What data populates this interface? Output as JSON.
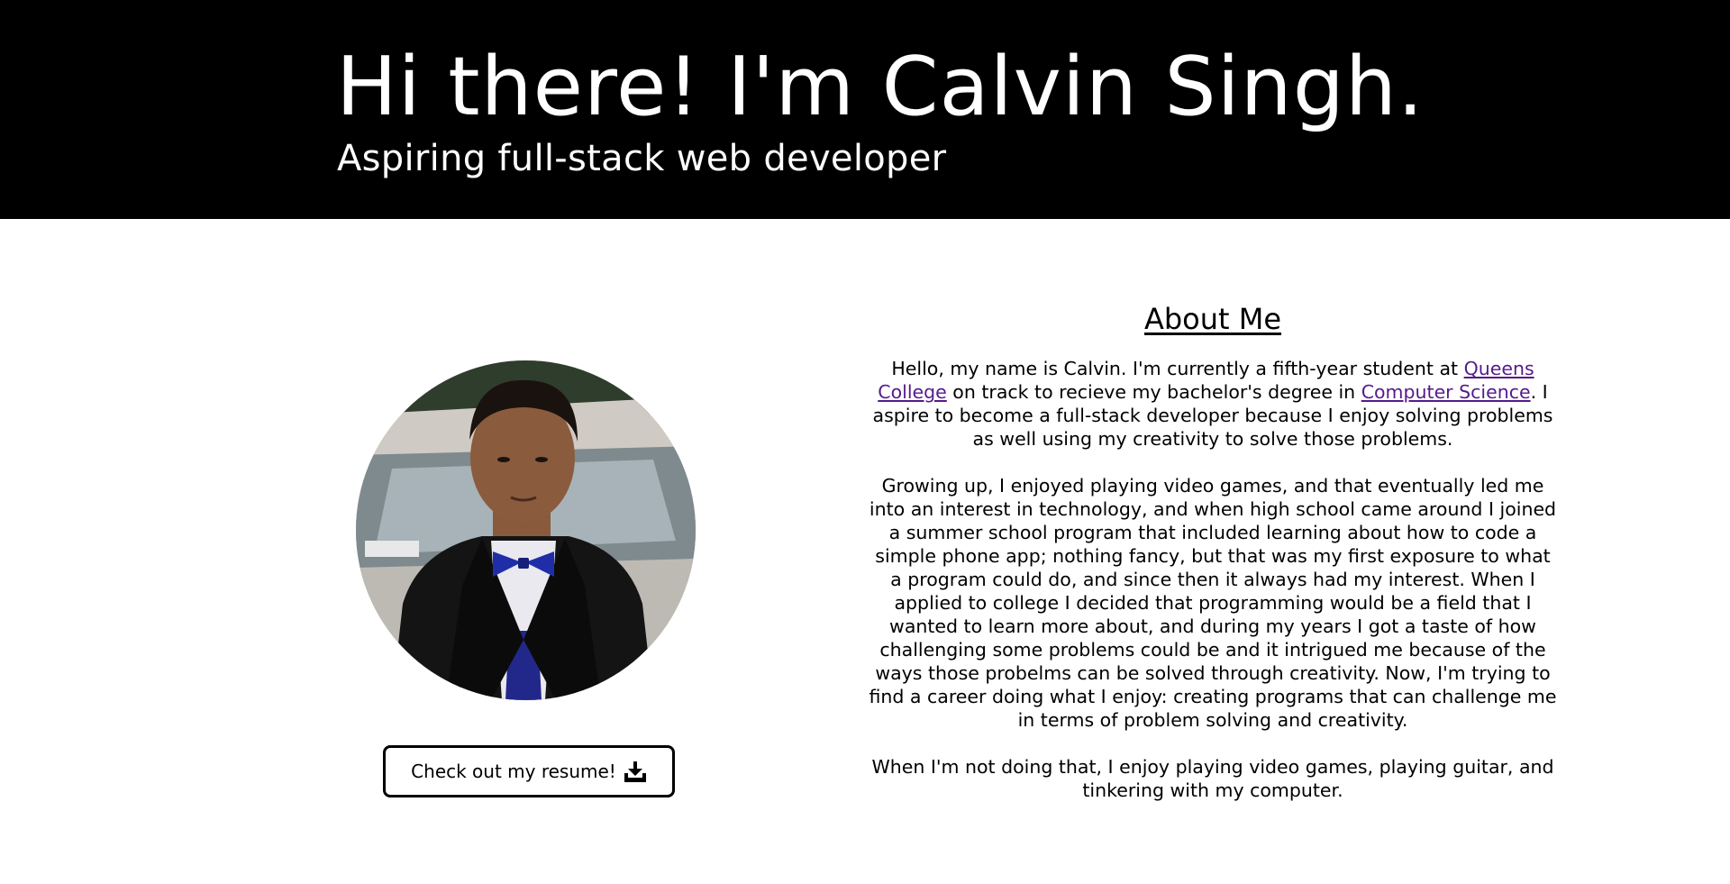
{
  "header": {
    "title": "Hi there! I'm Calvin Singh.",
    "subtitle": "Aspiring full-stack web developer"
  },
  "profile": {
    "photo_alt": "Calvin Singh",
    "resume_button_label": "Check out my resume!",
    "resume_icon": "download-icon"
  },
  "about": {
    "heading": "About Me",
    "paragraph1": {
      "part1": "Hello, my name is Calvin. I'm currently a fifth-year student at ",
      "link_college": "Queens College",
      "part2": " on track to recieve my bachelor's degree in ",
      "link_major": "Computer Science",
      "part3": ". I aspire to become a full-stack developer because I enjoy solving problems as well using my creativity to solve those problems."
    },
    "paragraph2": "Growing up, I enjoyed playing video games, and that eventually led me into an interest in technology, and when high school came around I joined a summer school program that included learning about how to code a simple phone app; nothing fancy, but that was my first exposure to what a program could do, and since then it always had my interest. When I applied to college I decided that programming would be a field that I wanted to learn more about, and during my years I got a taste of how challenging some problems could be and it intrigued me because of the ways those probelms can be solved through creativity. Now, I'm trying to find a career doing what I enjoy: creating programs that can challenge me in terms of problem solving and creativity.",
    "paragraph3": "When I'm not doing that, I enjoy playing video games, playing guitar, and tinkering with my computer."
  },
  "colors": {
    "header_bg": "#000000",
    "header_text": "#ffffff",
    "link": "#551a8b"
  }
}
